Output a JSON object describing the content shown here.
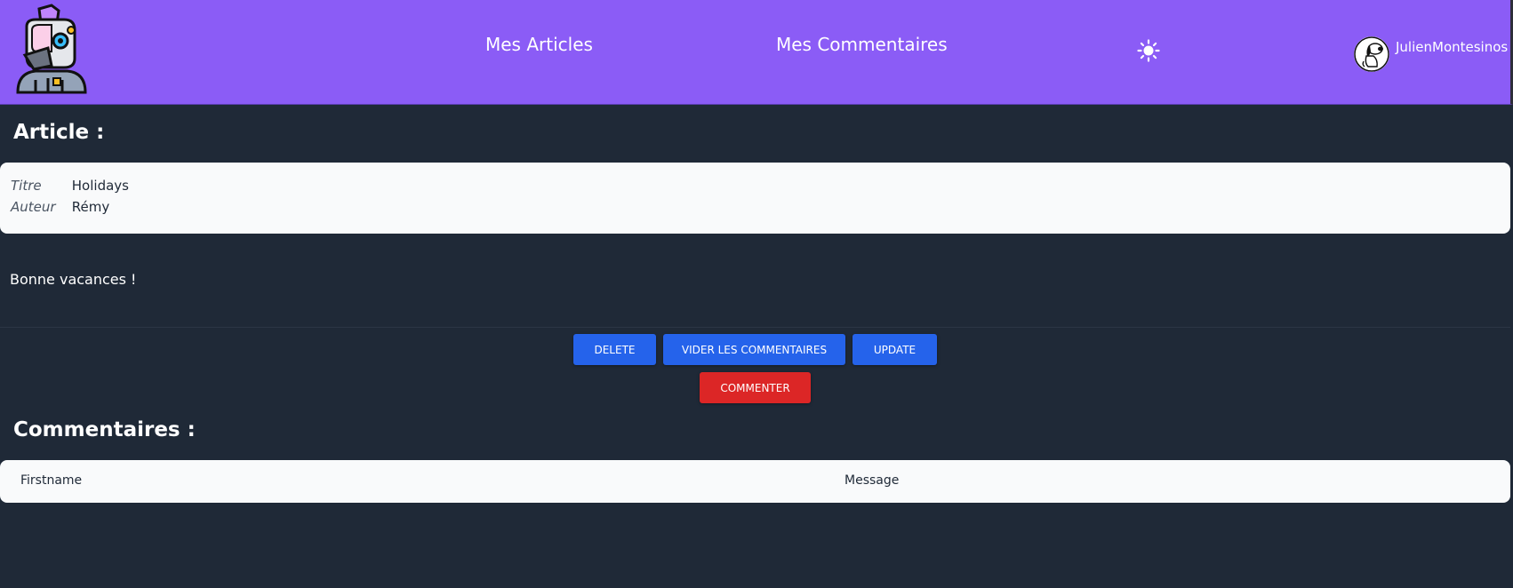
{
  "navbar": {
    "logo_icon": "robot-avatar-logo",
    "links": [
      {
        "label": "Mes Articles"
      },
      {
        "label": "Mes Commentaires"
      }
    ],
    "theme_icon": "sun-icon",
    "user": {
      "avatar_icon": "snoopy-avatar",
      "name": "JulienMontesinos"
    },
    "background_color": "#8b5cf6"
  },
  "article": {
    "section_title": "Article :",
    "fields": [
      {
        "label": "Titre",
        "value": "Holidays"
      },
      {
        "label": "Auteur",
        "value": "Rémy"
      }
    ],
    "body": "Bonne vacances !"
  },
  "actions": {
    "delete_label": "DELETE",
    "clear_comments_label": "VIDER LES COMMENTAIRES",
    "update_label": "UPDATE",
    "comment_label": "COMMENTER",
    "primary_color": "#2563eb",
    "danger_color": "#dc2626"
  },
  "comments": {
    "section_title": "Commentaires :",
    "columns": [
      "Firstname",
      "Message"
    ],
    "rows": []
  },
  "colors": {
    "page_background": "#1f2937",
    "card_background": "#f9fafb"
  }
}
